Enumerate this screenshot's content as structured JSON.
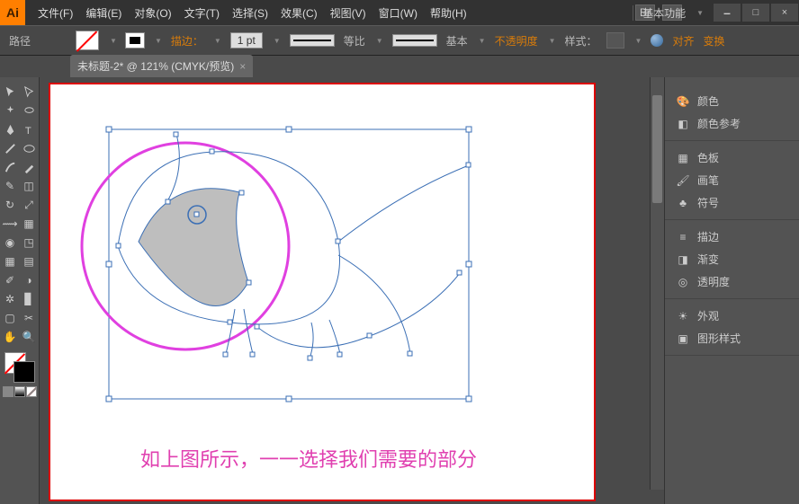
{
  "menu": {
    "items": [
      "文件(F)",
      "编辑(E)",
      "对象(O)",
      "文字(T)",
      "选择(S)",
      "效果(C)",
      "视图(V)",
      "窗口(W)",
      "帮助(H)"
    ]
  },
  "profile": {
    "label": "基本功能",
    "br": "Br"
  },
  "control": {
    "path": "路径",
    "stroke_label": "描边：",
    "pt": "1 pt",
    "prop": "等比",
    "basic": "基本",
    "opacity": "不透明度",
    "style": "样式：",
    "align": "对齐",
    "transform": "变换"
  },
  "tab": {
    "label": "未标题-2* @ 121% (CMYK/预览)"
  },
  "caption": "如上图所示，一一选择我们需要的部分",
  "panels": [
    {
      "icon": "palette",
      "label": "颜色"
    },
    {
      "icon": "guide",
      "label": "颜色参考"
    },
    {
      "icon": "swatches",
      "label": "色板"
    },
    {
      "icon": "brush",
      "label": "画笔"
    },
    {
      "icon": "symbols",
      "label": "符号"
    },
    {
      "icon": "stroke",
      "label": "描边"
    },
    {
      "icon": "gradient",
      "label": "渐变"
    },
    {
      "icon": "transparency",
      "label": "透明度"
    },
    {
      "icon": "appearance",
      "label": "外观"
    },
    {
      "icon": "graphic",
      "label": "图形样式"
    }
  ],
  "win": {
    "min": "–",
    "max": "□",
    "close": "×"
  }
}
